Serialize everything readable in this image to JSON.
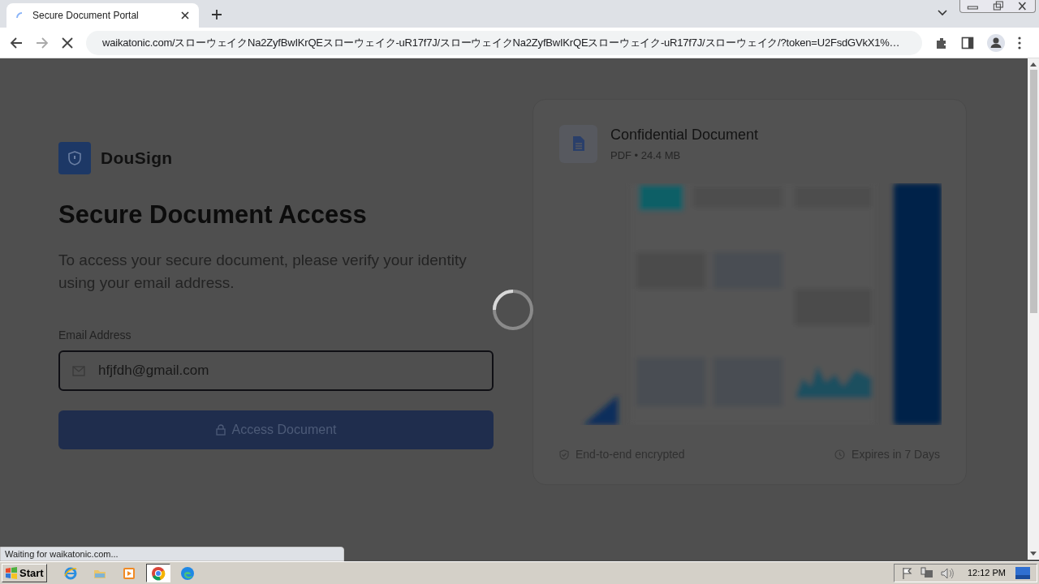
{
  "browser": {
    "tab": {
      "title": "Secure Document Portal",
      "loading": true
    },
    "url": "waikatonic.com/スローウェイクNa2ZyfBwIKrQEスローウェイク-uR17f7J/スローウェイクNa2ZyfBwIKrQEスローウェイク-uR17f7J/スローウェイク/?token=U2FsdGVkX1%…",
    "status": "Waiting for waikatonic.com..."
  },
  "page": {
    "brand": "DouSign",
    "heading": "Secure Document Access",
    "description": "To access your secure document, please verify your identity using your email address.",
    "email": {
      "label": "Email Address",
      "value": "hfjfdh@gmail.com"
    },
    "button": {
      "label": "Access Document",
      "disabled": true
    },
    "document": {
      "title": "Confidential Document",
      "meta": "PDF • 24.4 MB",
      "encryption": "End-to-end encrypted",
      "expiry": "Expires in 7 Days"
    }
  },
  "taskbar": {
    "start": "Start",
    "apps": [
      {
        "kind": "ie",
        "selected": false
      },
      {
        "kind": "folder",
        "selected": false
      },
      {
        "kind": "media",
        "selected": false
      },
      {
        "kind": "chrome",
        "selected": true
      },
      {
        "kind": "edge",
        "selected": false
      }
    ],
    "clock": "12:12 PM"
  }
}
